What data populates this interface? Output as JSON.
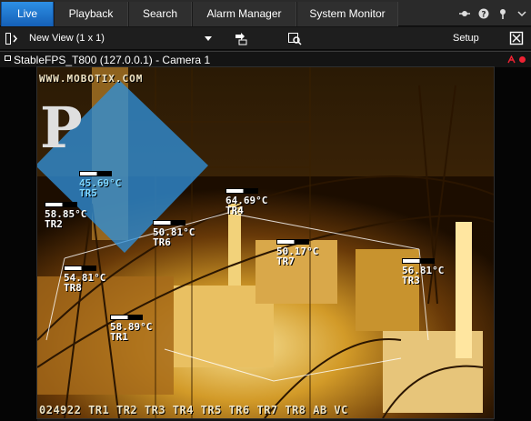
{
  "tabs": [
    {
      "label": "Live",
      "active": true
    },
    {
      "label": "Playback",
      "active": false
    },
    {
      "label": "Search",
      "active": false
    },
    {
      "label": "Alarm Manager",
      "active": false
    },
    {
      "label": "System Monitor",
      "active": false
    }
  ],
  "topbar_icons": [
    "network-icon",
    "help-icon",
    "pin-icon",
    "chevron-down-icon"
  ],
  "toolbar": {
    "view_name": "New View (1 x 1)",
    "setup_label": "Setup"
  },
  "camera": {
    "title": "StableFPS_T800 (127.0.0.1) - Camera 1",
    "watermark_url": "WWW.MOBOTIX.COM",
    "logo_letter": "P",
    "bottom_strip": "024922 TR1 TR2 TR3 TR4 TR5 TR6 TR7 TR8 AB VC"
  },
  "readings": [
    {
      "value": "45.69°C",
      "label": "TR5",
      "highlight": true
    },
    {
      "value": "58.85°C",
      "label": "TR2"
    },
    {
      "value": "50.81°C",
      "label": "TR6"
    },
    {
      "value": "64.69°C",
      "label": "TR4"
    },
    {
      "value": "50.17°C",
      "label": "TR7"
    },
    {
      "value": "56.81°C",
      "label": "TR3"
    },
    {
      "value": "54.81°C",
      "label": "TR8"
    },
    {
      "value": "58.89°C",
      "label": "TR1"
    }
  ],
  "colors": {
    "active_tab": "#1f78d1",
    "record_indicator": "#e22233",
    "highlight_overlay": "#2f8fd8"
  }
}
